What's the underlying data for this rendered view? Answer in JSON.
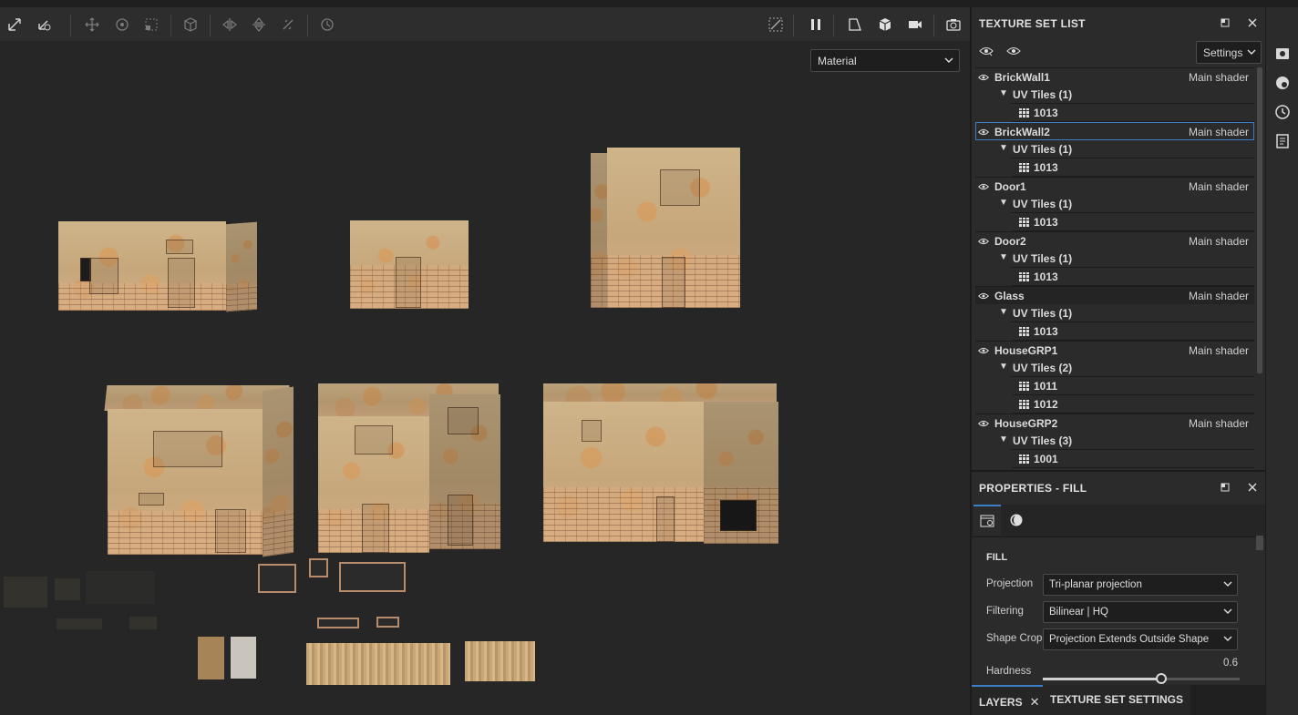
{
  "toolbar": {
    "icons": [
      "transform-icon",
      "transform-options-icon",
      "move-icon",
      "rotate-icon",
      "scale-icon",
      "cube-icon",
      "mirror-x-icon",
      "mirror-y-icon",
      "symmetry-icon",
      "history-icon",
      "hide-icon",
      "pause-icon",
      "view-mode-icon",
      "camera-icon",
      "video-icon",
      "screenshot-icon"
    ]
  },
  "viewport": {
    "channel_select": "Material"
  },
  "texture_set_list": {
    "title": "TEXTURE SET LIST",
    "settings_label": "Settings",
    "items": [
      {
        "name": "BrickWall1",
        "shader": "Main shader",
        "uv_label": "UV Tiles (1)",
        "tiles": [
          "1013"
        ]
      },
      {
        "name": "BrickWall2",
        "shader": "Main shader",
        "uv_label": "UV Tiles (1)",
        "tiles": [
          "1013"
        ],
        "selected": true
      },
      {
        "name": "Door1",
        "shader": "Main shader",
        "uv_label": "UV Tiles (1)",
        "tiles": [
          "1013"
        ]
      },
      {
        "name": "Door2",
        "shader": "Main shader",
        "uv_label": "UV Tiles (1)",
        "tiles": [
          "1013"
        ]
      },
      {
        "name": "Glass",
        "shader": "Main shader",
        "uv_label": "UV Tiles (1)",
        "tiles": [
          "1013"
        ]
      },
      {
        "name": "HouseGRP1",
        "shader": "Main shader",
        "uv_label": "UV Tiles (2)",
        "tiles": [
          "1011",
          "1012"
        ]
      },
      {
        "name": "HouseGRP2",
        "shader": "Main shader",
        "uv_label": "UV Tiles (3)",
        "tiles": [
          "1001"
        ]
      }
    ]
  },
  "properties": {
    "title": "PROPERTIES - FILL",
    "section": "FILL",
    "projection_label": "Projection",
    "projection_value": "Tri-planar projection",
    "filtering_label": "Filtering",
    "filtering_value": "Bilinear | HQ",
    "shape_crop_label": "Shape Crop",
    "shape_crop_value": "Projection Extends Outside Shape",
    "hardness_label": "Hardness",
    "hardness_value": "0.6",
    "hardness_fraction": 0.6
  },
  "bottom_tabs": {
    "layers": "LAYERS",
    "texture_set_settings": "TEXTURE SET SETTINGS"
  },
  "colors": {
    "accent": "#3d7fc7",
    "panel_bg": "#2b2b2b",
    "viewport_bg": "#262626"
  }
}
